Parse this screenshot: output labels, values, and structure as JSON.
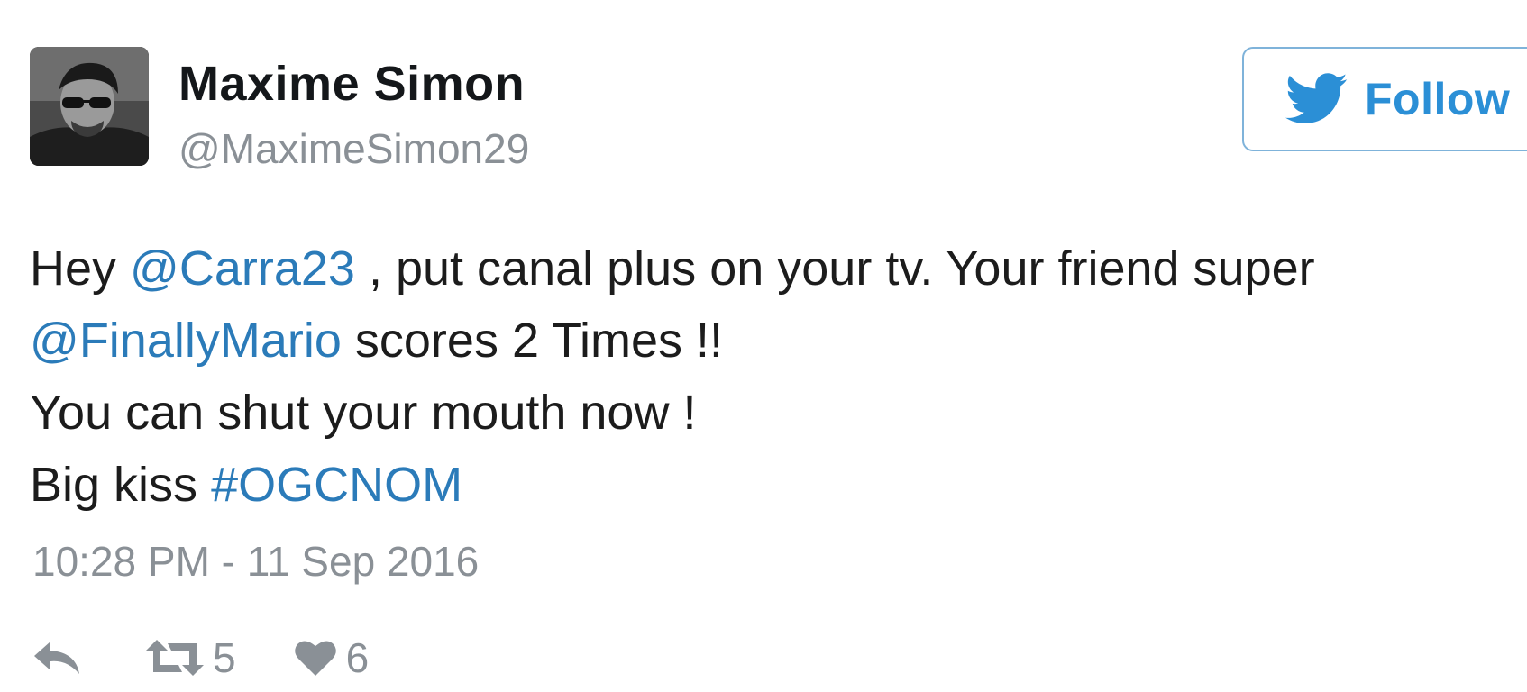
{
  "user": {
    "display_name": "Maxime Simon",
    "handle": "@MaximeSimon29"
  },
  "follow_button": {
    "label": "Follow"
  },
  "tweet": {
    "line1_prefix": "Hey ",
    "mention_1": "@Carra23",
    "line1_suffix": " , put canal plus on your tv. Your friend super",
    "mention_2": "@FinallyMario",
    "line2_suffix": " scores 2 Times !!",
    "line3": "You can shut your mouth now !",
    "line4_prefix": "Big kiss ",
    "hashtag": "#OGCNOM",
    "timestamp": "10:28 PM - 11 Sep 2016"
  },
  "actions": {
    "reply_icon": "reply-icon",
    "retweet_icon": "retweet-icon",
    "retweet_count": "5",
    "like_icon": "heart-icon",
    "like_count": "6"
  },
  "colors": {
    "link": "#2b7bb9",
    "brand": "#2b8fd6",
    "muted": "#8a9096",
    "text": "#1c1c1c"
  }
}
